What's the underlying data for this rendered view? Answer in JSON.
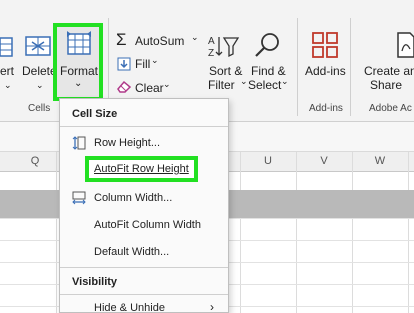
{
  "ribbon": {
    "insert_partial": "ert",
    "delete_label": "Delete",
    "format_label": "Format",
    "cells_group": "Cells",
    "autosum_label": "AutoSum",
    "fill_label": "Fill",
    "clear_label": "Clear",
    "sort_filter_line1": "Sort &",
    "sort_filter_line2": "Filter",
    "find_select_line1": "Find &",
    "find_select_line2": "Select",
    "addins_label": "Add-ins",
    "addins_group": "Add-ins",
    "create_label": "Create and",
    "share_label": "Share",
    "adobe_group": "Adobe Ac"
  },
  "sheet": {
    "columns": [
      "Q",
      "U",
      "V",
      "W"
    ]
  },
  "format_menu": {
    "cell_size_heading": "Cell Size",
    "items": {
      "row_height": "Row Height...",
      "autofit_row_height": "AutoFit Row Height",
      "column_width": "Column Width...",
      "autofit_column_width": "AutoFit Column Width",
      "default_width": "Default Width..."
    },
    "visibility_heading": "Visibility",
    "hide_unhide": "Hide & Unhide"
  },
  "colors": {
    "highlight": "#22e022",
    "addins_icon": "#c0392b",
    "row_band": "#b9b9b9"
  }
}
